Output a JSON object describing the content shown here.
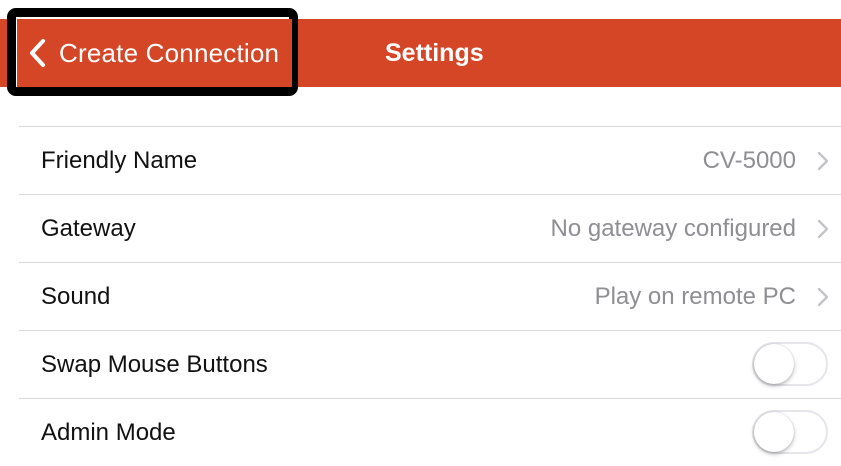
{
  "nav": {
    "back_label": "Create Connection",
    "title": "Settings"
  },
  "rows": [
    {
      "label": "Friendly Name",
      "value": "CV-5000"
    },
    {
      "label": "Gateway",
      "value": "No gateway configured"
    },
    {
      "label": "Sound",
      "value": "Play on remote PC"
    },
    {
      "label": "Swap Mouse Buttons",
      "toggle_on": false
    },
    {
      "label": "Admin Mode",
      "toggle_on": false
    }
  ],
  "colors": {
    "accent": "#d54627",
    "highlight_frame": "#000000",
    "secondary_text": "#8e8e93"
  },
  "icons": {
    "back": "chevron-left-icon",
    "disclosure": "chevron-right-icon"
  }
}
